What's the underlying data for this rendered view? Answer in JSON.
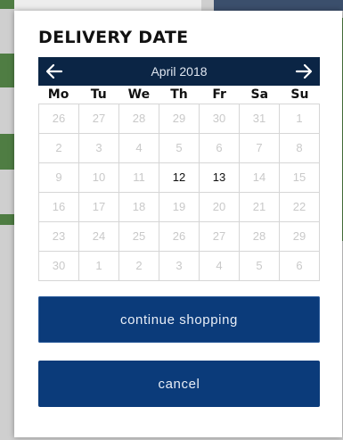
{
  "modal": {
    "title": "DELIVERY DATE"
  },
  "calendar": {
    "month_label": "April 2018",
    "prev_icon": "arrow-left-icon",
    "next_icon": "arrow-right-icon",
    "weekdays": [
      "Mo",
      "Tu",
      "We",
      "Th",
      "Fr",
      "Sa",
      "Su"
    ],
    "weeks": [
      [
        {
          "d": "26",
          "available": false
        },
        {
          "d": "27",
          "available": false
        },
        {
          "d": "28",
          "available": false
        },
        {
          "d": "29",
          "available": false
        },
        {
          "d": "30",
          "available": false
        },
        {
          "d": "31",
          "available": false
        },
        {
          "d": "1",
          "available": false
        }
      ],
      [
        {
          "d": "2",
          "available": false
        },
        {
          "d": "3",
          "available": false
        },
        {
          "d": "4",
          "available": false
        },
        {
          "d": "5",
          "available": false
        },
        {
          "d": "6",
          "available": false
        },
        {
          "d": "7",
          "available": false
        },
        {
          "d": "8",
          "available": false
        }
      ],
      [
        {
          "d": "9",
          "available": false
        },
        {
          "d": "10",
          "available": false
        },
        {
          "d": "11",
          "available": false
        },
        {
          "d": "12",
          "available": true
        },
        {
          "d": "13",
          "available": true
        },
        {
          "d": "14",
          "available": false
        },
        {
          "d": "15",
          "available": false
        }
      ],
      [
        {
          "d": "16",
          "available": false
        },
        {
          "d": "17",
          "available": false
        },
        {
          "d": "18",
          "available": false
        },
        {
          "d": "19",
          "available": false
        },
        {
          "d": "20",
          "available": false
        },
        {
          "d": "21",
          "available": false
        },
        {
          "d": "22",
          "available": false
        }
      ],
      [
        {
          "d": "23",
          "available": false
        },
        {
          "d": "24",
          "available": false
        },
        {
          "d": "25",
          "available": false
        },
        {
          "d": "26",
          "available": false
        },
        {
          "d": "27",
          "available": false
        },
        {
          "d": "28",
          "available": false
        },
        {
          "d": "29",
          "available": false
        }
      ],
      [
        {
          "d": "30",
          "available": false
        },
        {
          "d": "1",
          "available": false
        },
        {
          "d": "2",
          "available": false
        },
        {
          "d": "3",
          "available": false
        },
        {
          "d": "4",
          "available": false
        },
        {
          "d": "5",
          "available": false
        },
        {
          "d": "6",
          "available": false
        }
      ]
    ]
  },
  "buttons": {
    "continue_label": "continue shopping",
    "cancel_label": "cancel"
  },
  "colors": {
    "header_bg": "#0b2545",
    "button_bg": "#0b3b7a",
    "disabled_day": "#c9c9c9",
    "available_day": "#111111"
  }
}
